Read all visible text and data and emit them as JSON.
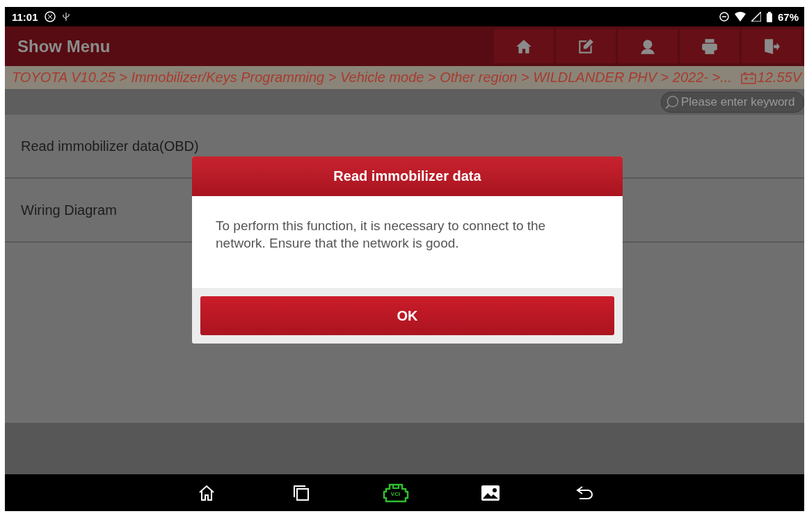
{
  "status_bar": {
    "time": "11:01",
    "battery": "67%"
  },
  "header": {
    "title": "Show Menu",
    "buttons": [
      {
        "kind": "home"
      },
      {
        "kind": "edit"
      },
      {
        "kind": "support"
      },
      {
        "kind": "print"
      },
      {
        "kind": "exit"
      }
    ]
  },
  "breadcrumb": {
    "path": "TOYOTA V10.25 > Immobilizer/Keys Programming > Vehicle mode > Other region > WILDLANDER PHV > 2022- >...",
    "voltage": "12.55V"
  },
  "search": {
    "placeholder": "Please enter keyword"
  },
  "menu_items": [
    {
      "label": "Read immobilizer data(OBD)"
    },
    {
      "label": "Wiring Diagram"
    }
  ],
  "dialog": {
    "title": "Read immobilizer data",
    "message": "To perform this function, it is necessary to connect to the network. Ensure that the network is good.",
    "button": "OK"
  },
  "nav_bar": {
    "vci_label": "VCI"
  }
}
